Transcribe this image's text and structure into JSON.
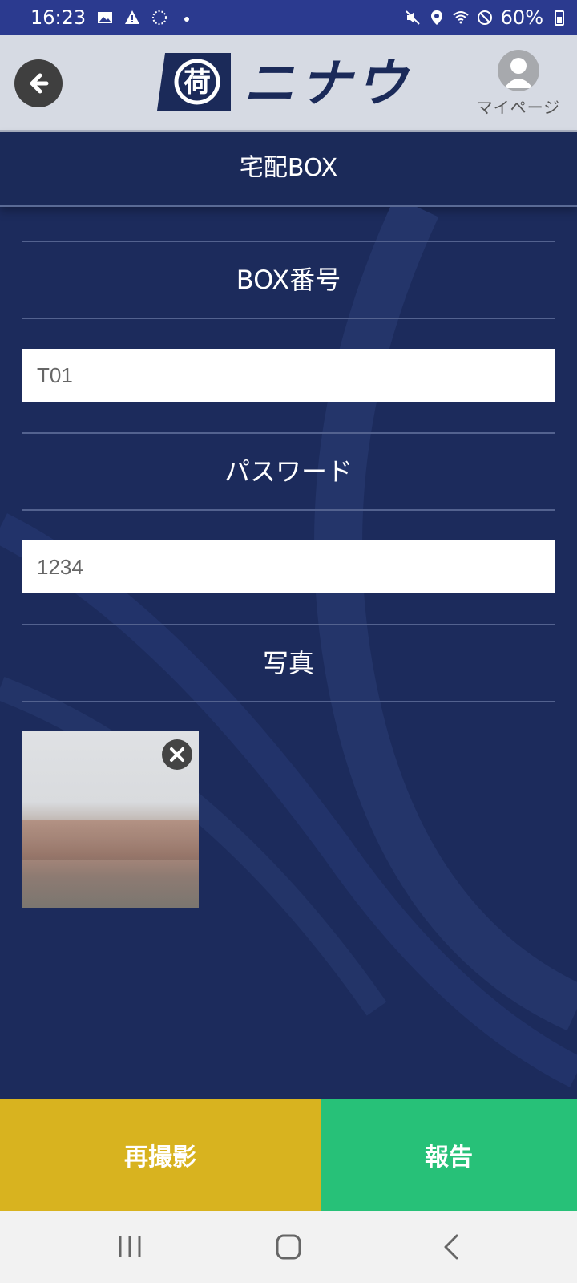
{
  "status_bar": {
    "time": "16:23",
    "battery": "60%",
    "icons_left": [
      "image-icon",
      "warning-icon",
      "loading-icon",
      "dot-icon"
    ],
    "icons_right": [
      "mute-icon",
      "location-icon",
      "wifi-icon",
      "dnd-icon",
      "battery-icon"
    ]
  },
  "header": {
    "logo_kanji": "荷",
    "logo_text": "ニナウ",
    "mypage_label": "マイページ"
  },
  "title": "宅配BOX",
  "form": {
    "box_number_label": "BOX番号",
    "box_number_value": "T01",
    "password_label": "パスワード",
    "password_value": "1234",
    "photo_label": "写真"
  },
  "actions": {
    "retake_label": "再撮影",
    "report_label": "報告",
    "retake_color": "#d8b31f",
    "report_color": "#27c178"
  },
  "colors": {
    "status_bar": "#2b3a8f",
    "header_bg": "#d6dae3",
    "page_bg": "#1c2b5c"
  }
}
